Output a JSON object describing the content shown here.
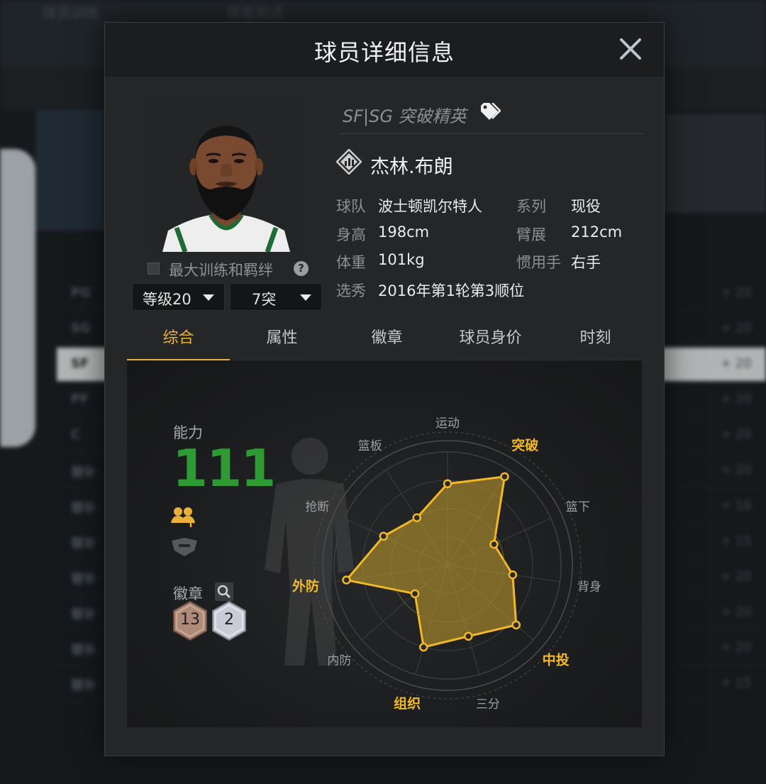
{
  "background": {
    "top_tabs": [
      "球员训练",
      "技能加点"
    ],
    "rows": [
      {
        "pos": "PG",
        "value": "+ 20"
      },
      {
        "pos": "SG",
        "value": "+ 20"
      },
      {
        "pos": "SF",
        "value": "+ 20"
      },
      {
        "pos": "PF",
        "value": "+ 20"
      },
      {
        "pos": "C",
        "value": "+ 20"
      },
      {
        "pos": "替补",
        "value": "+ 20"
      },
      {
        "pos": "替补",
        "value": "+ 16"
      },
      {
        "pos": "替补",
        "value": "+ 15"
      },
      {
        "pos": "替补",
        "value": "+ 20"
      },
      {
        "pos": "替补",
        "value": "+ 20"
      },
      {
        "pos": "替补",
        "value": "+ 20"
      },
      {
        "pos": "替补",
        "value": "+ 15"
      }
    ]
  },
  "modal": {
    "title": "球员详细信息",
    "close_icon": "close-icon"
  },
  "player": {
    "tagline": "SF|SG 突破精英",
    "name": "杰林.布朗",
    "max_training_label": "最大训练和羁绊",
    "help": "?",
    "level": "等级20",
    "breakthrough": "7突",
    "info": [
      {
        "label": "球队",
        "value": "波士顿凯尔特人"
      },
      {
        "label": "系列",
        "value": "现役"
      },
      {
        "label": "身高",
        "value": "198cm"
      },
      {
        "label": "臂展",
        "value": "212cm"
      },
      {
        "label": "体重",
        "value": "101kg"
      },
      {
        "label": "惯用手",
        "value": "右手"
      },
      {
        "label": "选秀",
        "value": "2016年第1轮第3顺位"
      }
    ]
  },
  "tabs": [
    {
      "label": "综合",
      "active": true
    },
    {
      "label": "属性",
      "active": false
    },
    {
      "label": "徽章",
      "active": false
    },
    {
      "label": "球员身价",
      "active": false
    },
    {
      "label": "时刻",
      "active": false
    }
  ],
  "overview": {
    "ability_label": "能力",
    "ability_value": "111",
    "badge_label": "徽章",
    "badges": [
      {
        "tier": "bronze",
        "count": "13",
        "color": "#b08a78"
      },
      {
        "tier": "silver",
        "count": "2",
        "color": "#c9cbd6"
      }
    ]
  },
  "chart_data": {
    "type": "radar",
    "axes": [
      {
        "label": "运动",
        "value": 0.72,
        "highlight": false
      },
      {
        "label": "突破",
        "value": 0.93,
        "highlight": true
      },
      {
        "label": "篮下",
        "value": 0.45,
        "highlight": false
      },
      {
        "label": "背身",
        "value": 0.58,
        "highlight": false
      },
      {
        "label": "中投",
        "value": 0.8,
        "highlight": true
      },
      {
        "label": "三分",
        "value": 0.65,
        "highlight": false
      },
      {
        "label": "组织",
        "value": 0.75,
        "highlight": true
      },
      {
        "label": "内防",
        "value": 0.38,
        "highlight": false
      },
      {
        "label": "外防",
        "value": 0.9,
        "highlight": true
      },
      {
        "label": "抢断",
        "value": 0.62,
        "highlight": false
      },
      {
        "label": "篮板",
        "value": 0.5,
        "highlight": false
      }
    ],
    "fill_color": "#c9a32f",
    "stroke_color": "#f2b825",
    "label_color": "#9c9fa3",
    "highlight_color": "#f2b825",
    "grid": true
  }
}
